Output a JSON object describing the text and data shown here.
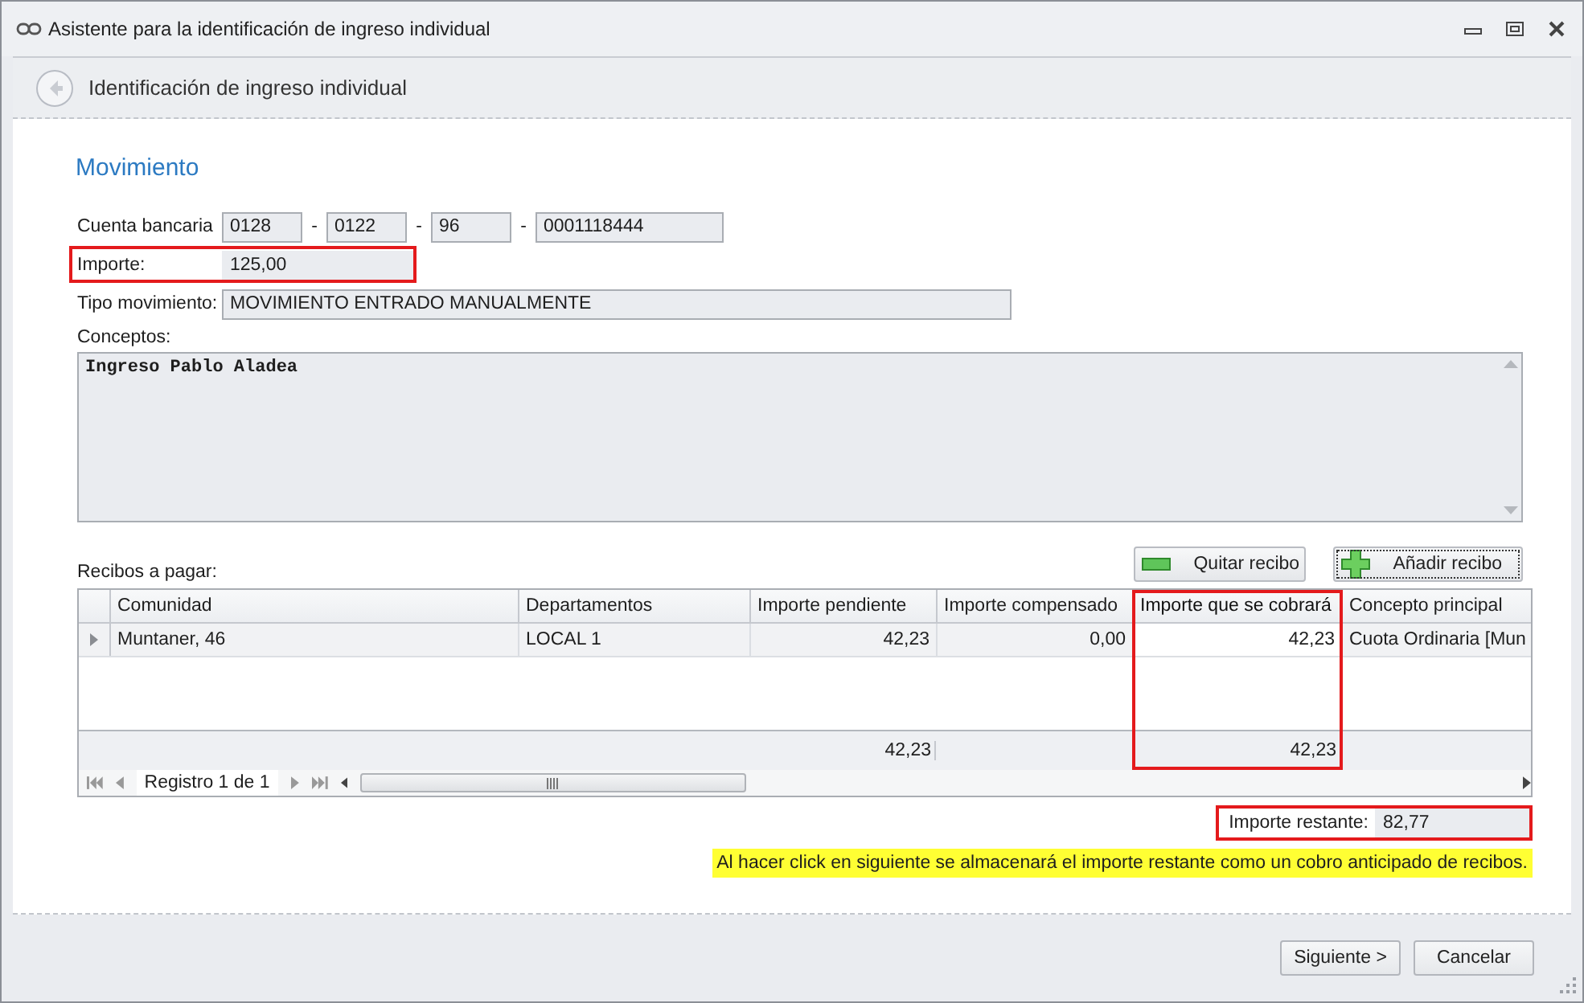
{
  "window": {
    "title": "Asistente para la identificación de ingreso individual"
  },
  "header": {
    "title": "Identificación de ingreso individual"
  },
  "section_title": "Movimiento",
  "bank_account": {
    "label": "Cuenta bancaria",
    "parts": [
      "0128",
      "0122",
      "96",
      "0001118444"
    ],
    "separators": [
      "-",
      "-",
      "-"
    ]
  },
  "amount": {
    "label": "Importe:",
    "value": "125,00",
    "highlighted": true
  },
  "movement_type": {
    "label": "Tipo movimiento:",
    "value": "MOVIMIENTO ENTRADO MANUALMENTE"
  },
  "concepts": {
    "label": "Conceptos:",
    "value": "Ingreso Pablo Aladea"
  },
  "receipts": {
    "label": "Recibos a pagar:",
    "buttons": [
      {
        "label": "Quitar recibo",
        "kind": "remove",
        "focused": false
      },
      {
        "label": "Añadir recibo",
        "kind": "add",
        "focused": true
      }
    ],
    "columns": [
      {
        "label": "Comunidad",
        "kind": "text",
        "highlighted": false
      },
      {
        "label": "Departamentos",
        "kind": "text",
        "highlighted": false
      },
      {
        "label": "Importe pendiente",
        "kind": "number",
        "highlighted": false,
        "total": "42,23"
      },
      {
        "label": "Importe compensado",
        "kind": "number",
        "highlighted": false
      },
      {
        "label": "Importe que se cobrará",
        "kind": "number",
        "highlighted": true,
        "total": "42,23"
      },
      {
        "label": "Concepto principal",
        "kind": "text",
        "highlighted": false
      }
    ],
    "rows": [
      {
        "selected": true,
        "cells": [
          "Muntaner, 46",
          "LOCAL 1",
          "42,23",
          "0,00",
          "42,23",
          "Cuota Ordinaria [Mun"
        ]
      }
    ],
    "navigator": "Registro 1 de 1"
  },
  "remaining": {
    "label": "Importe restante:",
    "value": "82,77",
    "highlighted": true
  },
  "notice": "Al hacer click en siguiente se almacenará el importe restante como un cobro anticipado de recibos.",
  "buttons": [
    {
      "label": "Siguiente >"
    },
    {
      "label": "Cancelar"
    }
  ]
}
